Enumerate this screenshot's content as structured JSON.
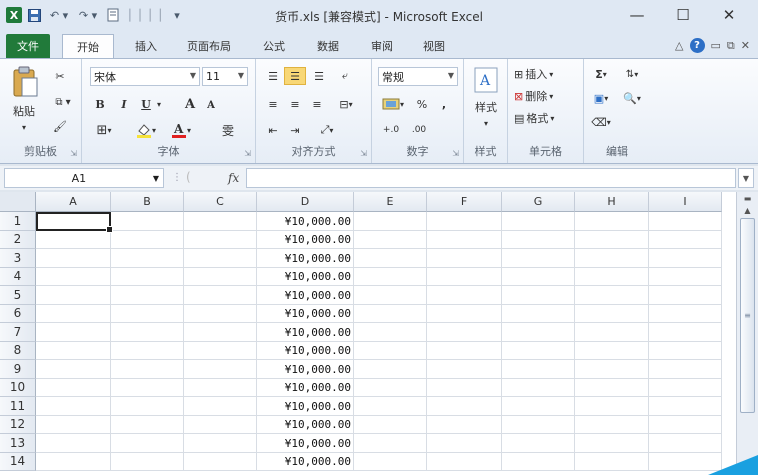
{
  "window": {
    "title": "货币.xls  [兼容模式] - Microsoft Excel",
    "minimize": "—",
    "maximize": "☐",
    "close": "✕"
  },
  "qat": {
    "app_icon": "X",
    "save": "💾",
    "undo": "↶ ▾",
    "redo": "↷ ▾",
    "more": "▾"
  },
  "tabs": [
    "文件",
    "开始",
    "插入",
    "页面布局",
    "公式",
    "数据",
    "审阅",
    "视图"
  ],
  "ribbon": {
    "clipboard": {
      "label": "剪贴板",
      "paste": "粘贴"
    },
    "font": {
      "label": "字体",
      "name": "宋体",
      "size": "11",
      "bold": "B",
      "italic": "I",
      "underline": "U",
      "grow": "A",
      "shrink": "A",
      "phonetic": "雯"
    },
    "alignment": {
      "label": "对齐方式"
    },
    "number": {
      "label": "数字",
      "format": "常规",
      "percent": "%",
      "comma": ",",
      "inc_dec": "+.0",
      "dec_dec": ".00"
    },
    "styles": {
      "label": "样式",
      "button": "样式"
    },
    "cells": {
      "label": "单元格",
      "insert": "插入",
      "delete": "删除",
      "format": "格式"
    },
    "editing": {
      "label": "编辑",
      "sum": "Σ"
    }
  },
  "formula_bar": {
    "name_box": "A1",
    "fx": "fx",
    "formula": ""
  },
  "sheet": {
    "columns": [
      "A",
      "B",
      "C",
      "D",
      "E",
      "F",
      "G",
      "H",
      "I"
    ],
    "rows": [
      "1",
      "2",
      "3",
      "4",
      "5",
      "6",
      "7",
      "8",
      "9",
      "10",
      "11",
      "12",
      "13",
      "14"
    ],
    "d_values": [
      "¥10,000.00",
      "¥10,000.00",
      "¥10,000.00",
      "¥10,000.00",
      "¥10,000.00",
      "¥10,000.00",
      "¥10,000.00",
      "¥10,000.00",
      "¥10,000.00",
      "¥10,000.00",
      "¥10,000.00",
      "¥10,000.00",
      "¥10,000.00",
      "¥10,000.00"
    ],
    "active_cell": "A1"
  }
}
